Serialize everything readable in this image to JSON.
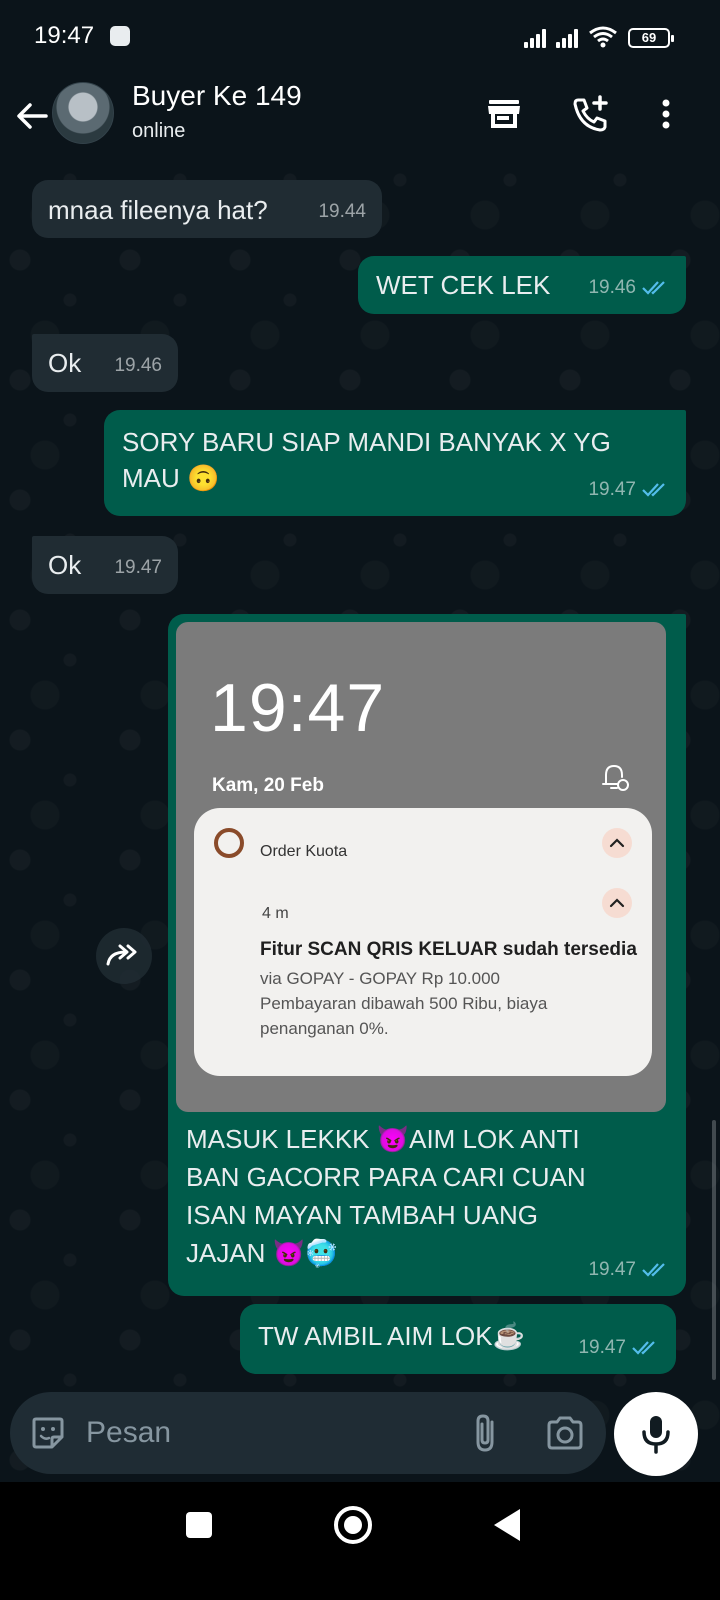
{
  "status_bar": {
    "time": "19:47",
    "battery": "69"
  },
  "header": {
    "contact_name": "Buyer Ke 149",
    "contact_status": "online"
  },
  "messages": [
    {
      "dir": "in",
      "text": "mnaa fileenya hat?",
      "time": "19.44"
    },
    {
      "dir": "out",
      "text": "WET CEK LEK",
      "time": "19.46"
    },
    {
      "dir": "in",
      "text": "Ok",
      "time": "19.46"
    },
    {
      "dir": "out",
      "text": "SORY BARU SIAP MANDI BANYAK X YG\nMAU 🙃",
      "time": "19.47"
    },
    {
      "dir": "in",
      "text": "Ok",
      "time": "19.47"
    },
    {
      "dir": "out",
      "text": "MASUK LEKKK 😈AIM LOK ANTI\nBAN GACORR PARA CARI CUAN\nISAN MAYAN TAMBAH UANG\nJAJAN 😈🥶",
      "time": "19.47"
    },
    {
      "dir": "out",
      "text": "TW AMBIL AIM LOK☕",
      "time": "19.47"
    }
  ],
  "screenshot": {
    "time": "19:47",
    "date": "Kam, 20 Feb",
    "app_name": "Order Kuota",
    "age": "4 m",
    "title": "Fitur SCAN QRIS KELUAR sudah tersedia",
    "body": "via GOPAY - GOPAY Rp 10.000\nPembayaran dibawah 500 Ribu, biaya\npenanganan 0%."
  },
  "input": {
    "placeholder": "Pesan"
  },
  "colors": {
    "incoming_bubble": "#202c33",
    "outgoing_bubble": "#005c4b",
    "read_ticks": "#53bdeb",
    "background": "#0b141a"
  }
}
